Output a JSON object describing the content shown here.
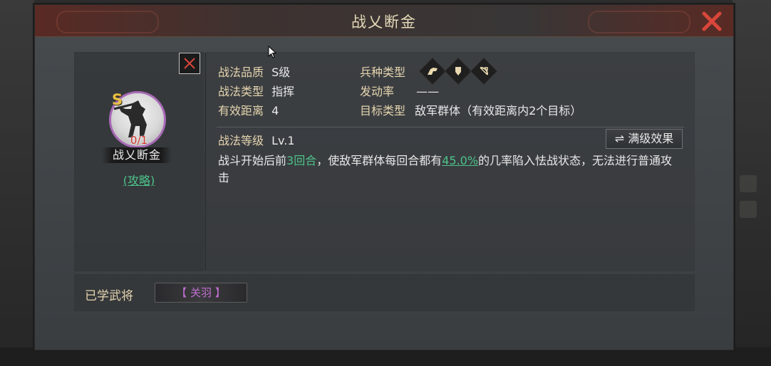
{
  "dialog": {
    "title": "战乂断金"
  },
  "card": {
    "grade": "S",
    "count": "0/1",
    "name": "战乂断金",
    "guide_link": "(攻略)"
  },
  "info": {
    "quality_label": "战法品质",
    "quality_value": "S级",
    "type_label": "战法类型",
    "type_value": "指挥",
    "distance_label": "有效距离",
    "distance_value": "4",
    "troop_label": "兵种类型",
    "troop_icons": [
      "cavalry-icon",
      "shield-icon",
      "bow-icon"
    ],
    "rate_label": "发动率",
    "rate_value": "——",
    "target_label": "目标类型",
    "target_value": "敌军群体（有效距离内2个目标）",
    "level_label": "战法等级",
    "level_value": "Lv.1",
    "max_button": "满级效果",
    "desc_part1": "战斗开始后前",
    "desc_rounds": "3回合",
    "desc_part2": "，使敌军群体每回合都有",
    "desc_percent": "45.0%",
    "desc_part3": "的几率陷入怯战状态，无法进行普通攻击"
  },
  "learned": {
    "label": "已学武将",
    "generals": [
      "【 关羽 】"
    ]
  },
  "colors": {
    "label_gold": "#e6d5b0",
    "highlight_green": "#4cc38a",
    "close_red": "#d8463a",
    "general_purple": "#c06fd0",
    "grade_gold": "#e9c046"
  }
}
